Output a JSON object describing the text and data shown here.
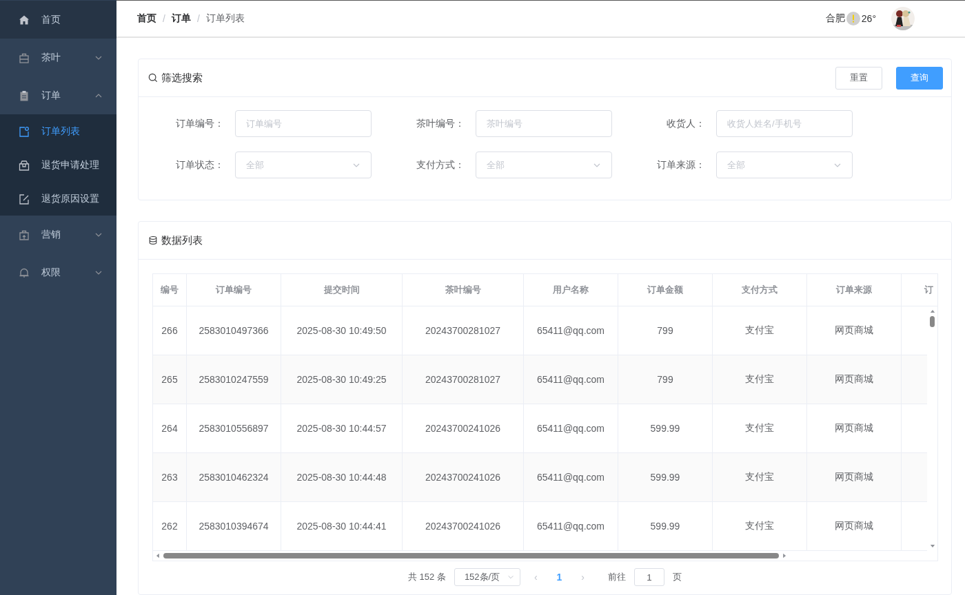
{
  "sidebar": {
    "items": [
      {
        "label": "首页",
        "kind": "link",
        "selected": false
      },
      {
        "label": "茶叶",
        "kind": "group",
        "expanded": false,
        "selected": false
      },
      {
        "label": "订单",
        "kind": "group",
        "expanded": true,
        "selected": false,
        "children": [
          {
            "label": "订单列表",
            "selected": true
          },
          {
            "label": "退货申请处理",
            "selected": false
          },
          {
            "label": "退货原因设置",
            "selected": false
          }
        ]
      },
      {
        "label": "营销",
        "kind": "group",
        "expanded": false,
        "selected": false
      },
      {
        "label": "权限",
        "kind": "group",
        "expanded": false,
        "selected": false
      }
    ]
  },
  "breadcrumb": [
    {
      "label": "首页",
      "bold": true
    },
    {
      "label": "订单",
      "bold": true
    },
    {
      "label": "订单列表",
      "bold": false
    }
  ],
  "breadcrumb_separator": "/",
  "header": {
    "city": "合肥",
    "temperature": "26°"
  },
  "filter": {
    "title": "筛选搜索",
    "reset_button": "重置",
    "search_button": "查询",
    "fields": [
      {
        "label": "订单编号：",
        "placeholder": "订单编号",
        "kind": "input"
      },
      {
        "label": "茶叶编号：",
        "placeholder": "茶叶编号",
        "kind": "input"
      },
      {
        "label": "收货人：",
        "placeholder": "收货人姓名/手机号",
        "kind": "input"
      },
      {
        "label": "订单状态：",
        "placeholder": "全部",
        "kind": "select"
      },
      {
        "label": "支付方式：",
        "placeholder": "全部",
        "kind": "select"
      },
      {
        "label": "订单来源：",
        "placeholder": "全部",
        "kind": "select"
      }
    ]
  },
  "table": {
    "title": "数据列表",
    "columns": [
      "编号",
      "订单编号",
      "提交时间",
      "茶叶编号",
      "用户名称",
      "订单金额",
      "支付方式",
      "订单来源",
      "订"
    ],
    "rows": [
      [
        "266",
        "2583010497366",
        "2025-08-30 10:49:50",
        "20243700281027",
        "65411@qq.com",
        "799",
        "支付宝",
        "网页商城"
      ],
      [
        "265",
        "2583010247559",
        "2025-08-30 10:49:25",
        "20243700281027",
        "65411@qq.com",
        "799",
        "支付宝",
        "网页商城"
      ],
      [
        "264",
        "2583010556897",
        "2025-08-30 10:44:57",
        "20243700241026",
        "65411@qq.com",
        "599.99",
        "支付宝",
        "网页商城"
      ],
      [
        "263",
        "2583010462324",
        "2025-08-30 10:44:48",
        "20243700241026",
        "65411@qq.com",
        "599.99",
        "支付宝",
        "网页商城"
      ],
      [
        "262",
        "2583010394674",
        "2025-08-30 10:44:41",
        "20243700241026",
        "65411@qq.com",
        "599.99",
        "支付宝",
        "网页商城"
      ]
    ]
  },
  "pagination": {
    "total": "共 152 条",
    "page_size": "152条/页",
    "prev": "‹",
    "pages": [
      {
        "label": "1",
        "selected": true
      }
    ],
    "next": "›",
    "goto_label": "前往",
    "goto_value": "1",
    "goto_suffix": "页"
  }
}
